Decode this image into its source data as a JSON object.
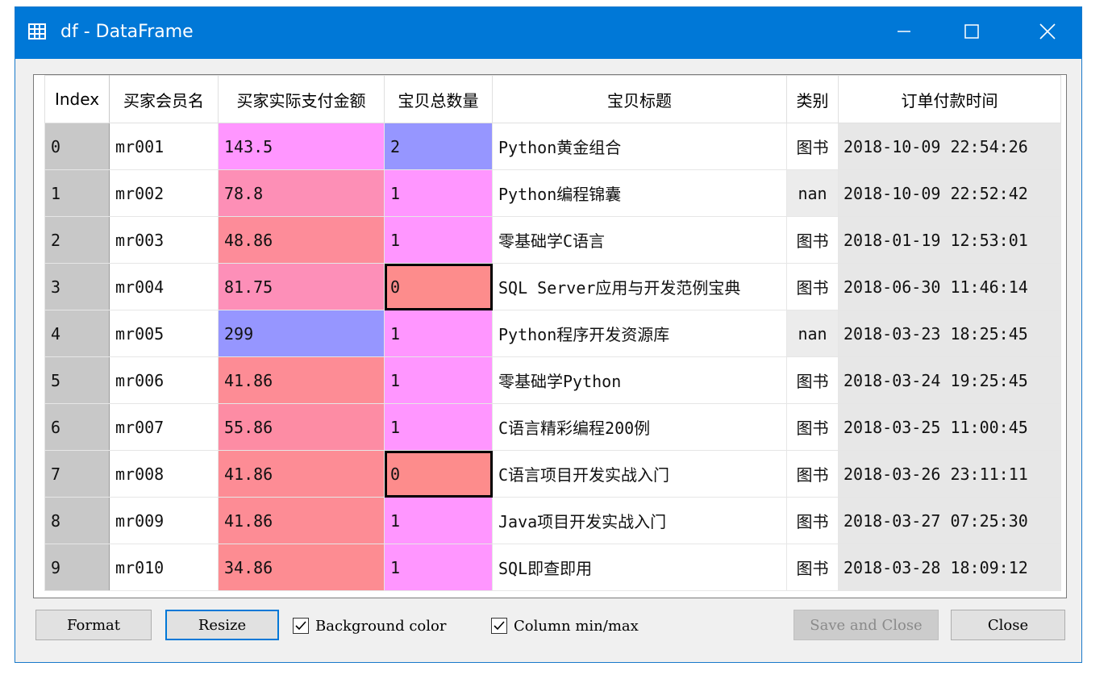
{
  "window": {
    "title": "df - DataFrame",
    "icons": {
      "app": "table-grid-icon",
      "minimize": "minimize-icon",
      "maximize": "maximize-icon",
      "close": "close-icon"
    }
  },
  "table": {
    "columns": [
      {
        "label": "Index"
      },
      {
        "label": "买家会员名"
      },
      {
        "label": "买家实际支付金额"
      },
      {
        "label": "宝贝总数量"
      },
      {
        "label": "宝贝标题"
      },
      {
        "label": "类别"
      },
      {
        "label": "订单付款时间"
      }
    ],
    "rows": [
      {
        "index": "0",
        "member": "mr001",
        "amount": "143.5",
        "qty": "2",
        "title": "Python黄金组合",
        "category": "图书",
        "time": "2018-10-09 22:54:26"
      },
      {
        "index": "1",
        "member": "mr002",
        "amount": "78.8",
        "qty": "1",
        "title": "Python编程锦囊",
        "category": "nan",
        "time": "2018-10-09 22:52:42"
      },
      {
        "index": "2",
        "member": "mr003",
        "amount": "48.86",
        "qty": "1",
        "title": "零基础学C语言",
        "category": "图书",
        "time": "2018-01-19 12:53:01"
      },
      {
        "index": "3",
        "member": "mr004",
        "amount": "81.75",
        "qty": "0",
        "title": "SQL Server应用与开发范例宝典",
        "category": "图书",
        "time": "2018-06-30 11:46:14"
      },
      {
        "index": "4",
        "member": "mr005",
        "amount": "299",
        "qty": "1",
        "title": "Python程序开发资源库",
        "category": "nan",
        "time": "2018-03-23 18:25:45"
      },
      {
        "index": "5",
        "member": "mr006",
        "amount": "41.86",
        "qty": "1",
        "title": "零基础学Python",
        "category": "图书",
        "time": "2018-03-24 19:25:45"
      },
      {
        "index": "6",
        "member": "mr007",
        "amount": "55.86",
        "qty": "1",
        "title": "C语言精彩编程200例",
        "category": "图书",
        "time": "2018-03-25 11:00:45"
      },
      {
        "index": "7",
        "member": "mr008",
        "amount": "41.86",
        "qty": "0",
        "title": "C语言项目开发实战入门",
        "category": "图书",
        "time": "2018-03-26 23:11:11"
      },
      {
        "index": "8",
        "member": "mr009",
        "amount": "41.86",
        "qty": "1",
        "title": "Java项目开发实战入门",
        "category": "图书",
        "time": "2018-03-27 07:25:30"
      },
      {
        "index": "9",
        "member": "mr010",
        "amount": "34.86",
        "qty": "1",
        "title": "SQL即查即用",
        "category": "图书",
        "time": "2018-03-28 18:09:12"
      }
    ],
    "cell_colors": {
      "amount": [
        "#ff96ff",
        "#fd8fb6",
        "#fd8c99",
        "#fd8fb8",
        "#9696ff",
        "#fd8c95",
        "#fd8ca4",
        "#fd8c95",
        "#fd8c95",
        "#fd8c92"
      ],
      "qty": [
        "#9696ff",
        "#ff96ff",
        "#ff96ff",
        "#fd8c8c",
        "#ff96ff",
        "#ff96ff",
        "#ff96ff",
        "#fd8c8c",
        "#ff96ff",
        "#ff96ff"
      ]
    },
    "selected_qty_rows": [
      3,
      7
    ]
  },
  "buttons": {
    "format": "Format",
    "resize": "Resize",
    "save_close": "Save and Close",
    "close": "Close"
  },
  "checkboxes": {
    "background_color": {
      "label": "Background color",
      "checked": true
    },
    "column_minmax": {
      "label": "Column min/max",
      "checked": true
    }
  },
  "colors": {
    "titlebar": "#0078d7",
    "accent": "#0078d7"
  }
}
